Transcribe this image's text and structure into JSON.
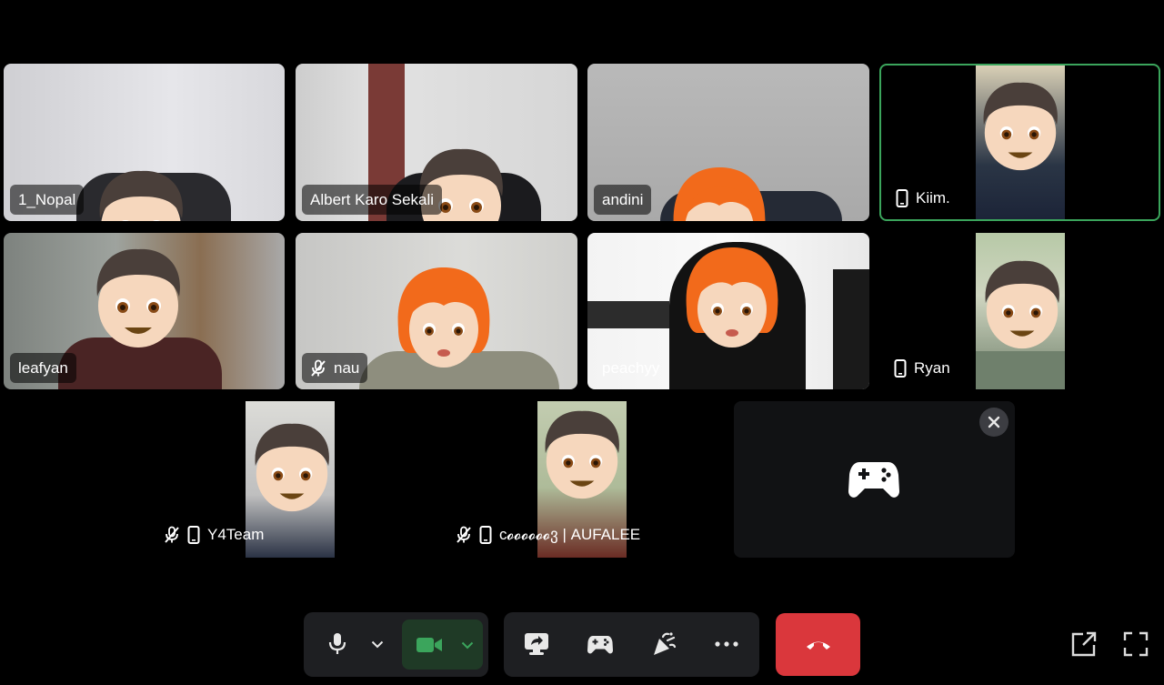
{
  "participants": [
    {
      "name": "1_Nopal",
      "avatar": "boy-avatar"
    },
    {
      "name": "Albert Karo Sekali",
      "avatar": "boy-avatar"
    },
    {
      "name": "andini",
      "avatar": "girl-avatar"
    },
    {
      "name": "Kiim.",
      "avatar": "boy-avatar",
      "device": "mobile-icon",
      "speaking": true
    },
    {
      "name": "leafyan",
      "avatar": "boy-avatar"
    },
    {
      "name": "nau",
      "avatar": "girl-avatar",
      "muted": true
    },
    {
      "name": "peachyy",
      "avatar": "girl-avatar"
    },
    {
      "name": "Ryan",
      "avatar": "boy-avatar",
      "device": "mobile-icon"
    },
    {
      "name": "Y4Team",
      "avatar": "boy-avatar",
      "muted": true,
      "device": "mobile-icon"
    },
    {
      "name": "c𝓸𝓸𝓸𝓸𝓸𝓸ვ | AUFALEE",
      "avatar": "boy-avatar",
      "muted": true,
      "device": "mobile-icon"
    }
  ],
  "activity_tile": {
    "icon": "gamepad-icon",
    "close_icon": "close-icon"
  },
  "controls": {
    "mic": "microphone-icon",
    "mic_options": "chevron-down-icon",
    "camera": "video-camera-icon",
    "camera_options": "chevron-down-icon",
    "screen_share": "screen-share-icon",
    "activities": "gamepad-icon",
    "soundboard": "soundboard-icon",
    "more": "more-icon",
    "disconnect": "hang-up-icon",
    "popout": "popout-icon",
    "fullscreen": "fullscreen-icon"
  },
  "colors": {
    "speaking_border": "#3ba55c",
    "camera_active": "#3ba55c",
    "hangup": "#da373c",
    "control_bg": "#1e1f22"
  }
}
